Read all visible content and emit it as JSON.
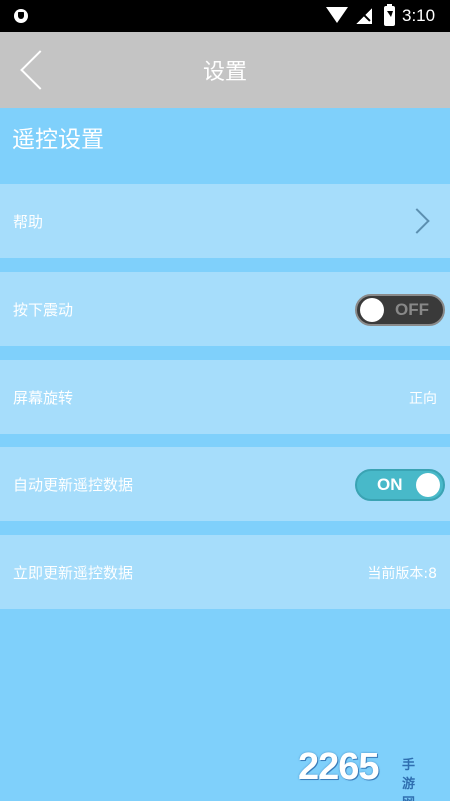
{
  "status_bar": {
    "time": "3:10",
    "icons": [
      "shield-icon",
      "wifi-icon",
      "no-signal-icon",
      "battery-charging-icon"
    ]
  },
  "header": {
    "title": "设置",
    "back_icon": "chevron-left-icon"
  },
  "section": {
    "title": "遥控设置"
  },
  "rows": [
    {
      "label": "帮助",
      "type": "link",
      "icon": "chevron-right-icon"
    },
    {
      "label": "按下震动",
      "type": "toggle",
      "state": "OFF"
    },
    {
      "label": "屏幕旋转",
      "type": "value",
      "value": "正向"
    },
    {
      "label": "自动更新遥控数据",
      "type": "toggle",
      "state": "ON"
    },
    {
      "label": "立即更新遥控数据",
      "type": "value",
      "value": "当前版本:8"
    }
  ],
  "watermark": {
    "number": "2265",
    "text": "手游网"
  },
  "colors": {
    "background": "#7fd0fb",
    "row": "#a6ddfb",
    "titlebar": "#c4c4c4",
    "toggle_on": "#48b9c9",
    "toggle_off": "#3a3a3a"
  }
}
